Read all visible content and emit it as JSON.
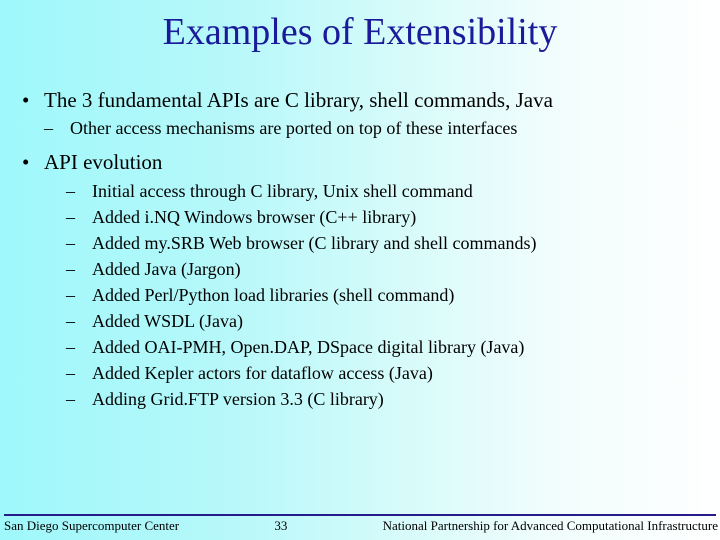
{
  "title": "Examples of Extensibility",
  "bullets": {
    "b1_1": "The 3 fundamental APIs are C library, shell commands, Java",
    "b1_1_sub": "Other access mechanisms are ported on top of these interfaces",
    "b1_2": "API evolution",
    "sub": [
      "Initial access through C library, Unix shell command",
      "Added i.NQ Windows browser (C++ library)",
      "Added my.SRB Web browser (C library and shell commands)",
      "Added Java (Jargon)",
      "Added Perl/Python load libraries (shell command)",
      "Added WSDL (Java)",
      "Added OAI-PMH, Open.DAP, DSpace digital library (Java)",
      "Added Kepler actors for dataflow access (Java)",
      "Adding Grid.FTP version 3.3 (C library)"
    ]
  },
  "footer": {
    "left": "San Diego Supercomputer Center",
    "center": "33",
    "right": "National Partnership for Advanced Computational Infrastructure"
  }
}
